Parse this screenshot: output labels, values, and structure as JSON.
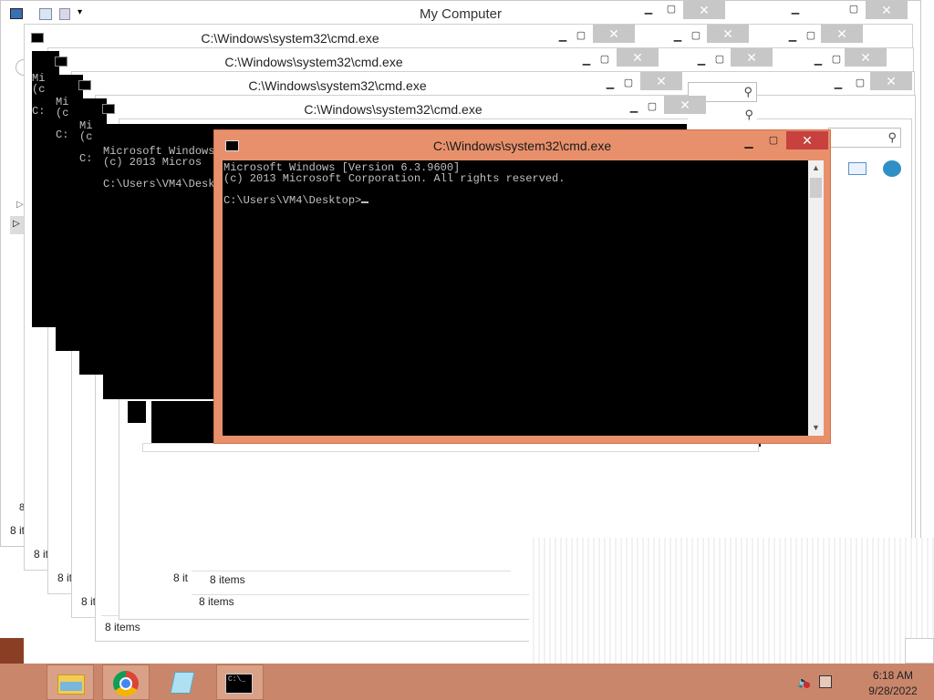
{
  "explorer": {
    "title": "My Computer",
    "status_items": "8 items",
    "status_items_short": "8 it",
    "search_icon": "search-icon"
  },
  "cmd": {
    "title": "C:\\Windows\\system32\\cmd.exe",
    "line1": "Microsoft Windows [Version 6.3.9600]",
    "line2": "(c) 2013 Microsoft Corporation. All rights reserved.",
    "line3": "C:\\Users\\VM4\\Desktop>",
    "back_line1": "Microsoft Windows [Version 6.3.9600]",
    "back_line2": "(c) 2013 Micros",
    "back_line3": "C:\\Users\\VM4\\Desktop>",
    "stub_mi": "Mi",
    "stub_c_paren": "(c",
    "stub_c": "C:"
  },
  "taskbar": {
    "apps": [
      "file-explorer",
      "chrome",
      "notepad",
      "command-prompt"
    ],
    "time": "6:18 AM",
    "date": "9/28/2022"
  },
  "colors": {
    "active_frame": "#e8906b",
    "close_active": "#c7413e",
    "taskbar": "#c9866a"
  }
}
